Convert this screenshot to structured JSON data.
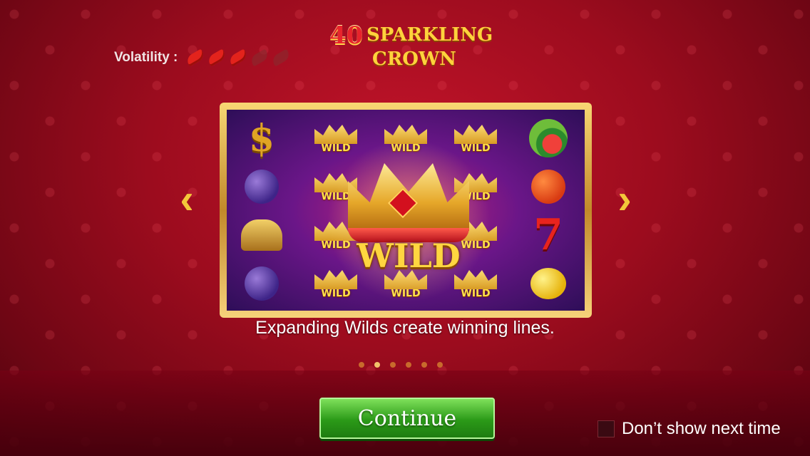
{
  "title": {
    "number": "40",
    "line1": "SPARKLING",
    "line2": "CROWN"
  },
  "volatility": {
    "label": "Volatility :",
    "level": 3,
    "max": 5
  },
  "nav": {
    "prev": "‹",
    "next": "›"
  },
  "reels": {
    "col1": [
      "dollar",
      "plum",
      "bell",
      "plum"
    ],
    "col5": [
      "watermelon",
      "orange",
      "seven",
      "lemon"
    ],
    "dollar_glyph": "$",
    "seven_glyph": "7",
    "wild_label": "WILD",
    "big_wild_label": "WILD"
  },
  "caption": "Expanding Wilds create winning lines.",
  "pager": {
    "count": 6,
    "active": 1
  },
  "continue_label": "Continue",
  "dont_show_label": "Don’t show next time"
}
